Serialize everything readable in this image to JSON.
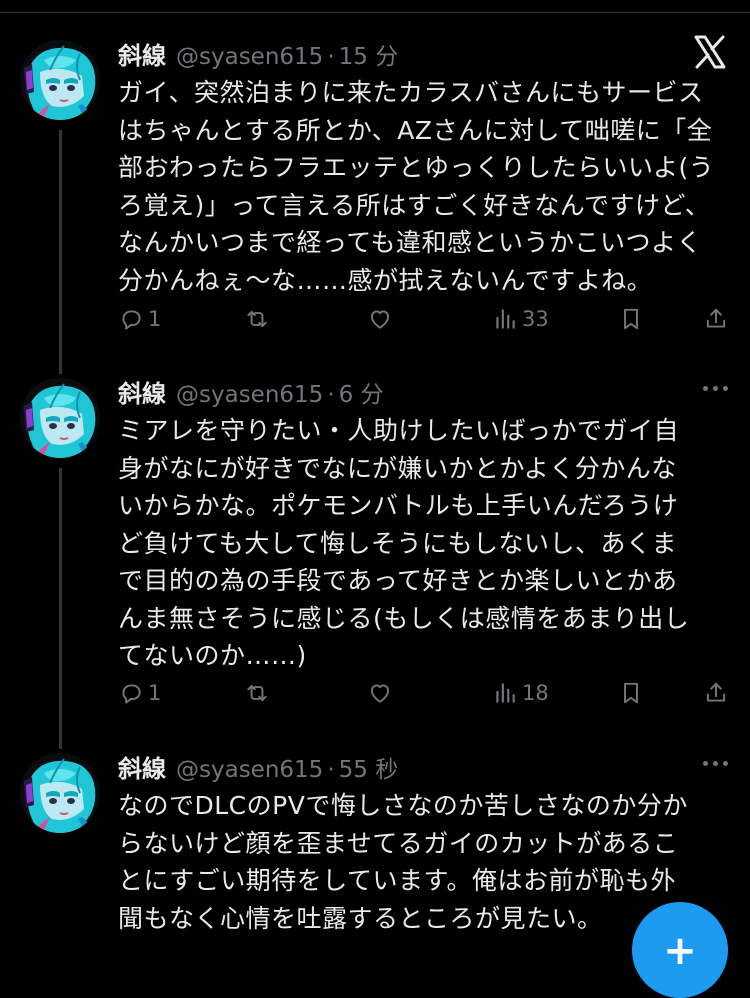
{
  "tweets": [
    {
      "name": "斜線",
      "handle": "@syasen615",
      "dot": "·",
      "time": "15 分",
      "text": "ガイ、突然泊まりに来たカラスバさんにもサービス\nはちゃんとする所とか、AZさんに対して咄嗟に「全\n部おわったらフラエッテとゆっくりしたらいいよ(う\nろ覚え)」って言える所はすごく好きなんですけど、\nなんかいつまで経っても違和感というかこいつよく\n分かんねぇ〜な……感が拭えないんですよね。",
      "replies": "1",
      "views": "33"
    },
    {
      "name": "斜線",
      "handle": "@syasen615",
      "dot": "·",
      "time": "6 分",
      "text": "ミアレを守りたい・人助けしたいばっかでガイ自\n身がなにが好きでなにが嫌いかとかよく分かんな\nいからかな。ポケモンバトルも上手いんだろうけ\nど負けても大して悔しそうにもしないし、あくま\nで目的の為の手段であって好きとか楽しいとかあ\nんま無さそうに感じる(もしくは感情をあまり出し\nてないのか……)",
      "replies": "1",
      "views": "18"
    },
    {
      "name": "斜線",
      "handle": "@syasen615",
      "dot": "·",
      "time": "55 秒",
      "text": "なのでDLCのPVで悔しさなのか苦しさなのか分か\nらないけど顔を歪ませてるガイのカットがあるこ\nとにすごい期待をしています。俺はお前が恥も外\n聞もなく心情を吐露するところが見たい。"
    }
  ],
  "fab": {
    "label": "+"
  },
  "icons": {
    "logo": "x-logo-icon",
    "reply": "reply-icon",
    "repost": "repost-icon",
    "like": "like-icon",
    "views": "views-icon",
    "bookmark": "bookmark-icon",
    "share": "share-icon",
    "more": "more-icon"
  },
  "colors": {
    "background": "#000000",
    "text": "#e7e9ea",
    "muted": "#71767b",
    "accent": "#1d9bf0"
  }
}
